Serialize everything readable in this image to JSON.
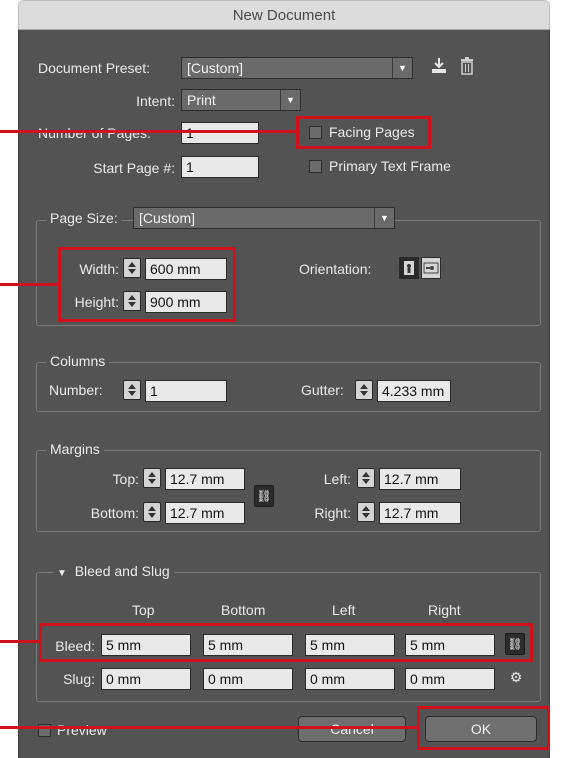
{
  "window": {
    "title": "New Document"
  },
  "document_preset": {
    "label": "Document Preset:",
    "value": "[Custom]"
  },
  "intent": {
    "label": "Intent:",
    "value": "Print"
  },
  "number_of_pages": {
    "label": "Number of Pages:",
    "value": "1"
  },
  "start_page": {
    "label": "Start Page #:",
    "value": "1"
  },
  "facing_pages": {
    "label": "Facing Pages",
    "checked": false
  },
  "primary_text_frame": {
    "label": "Primary Text Frame",
    "checked": false
  },
  "page_size": {
    "label": "Page Size:",
    "value": "[Custom]",
    "width_label": "Width:",
    "width": "600 mm",
    "height_label": "Height:",
    "height": "900 mm",
    "orientation_label": "Orientation:"
  },
  "columns": {
    "title": "Columns",
    "number_label": "Number:",
    "number": "1",
    "gutter_label": "Gutter:",
    "gutter": "4.233 mm"
  },
  "margins": {
    "title": "Margins",
    "top_label": "Top:",
    "top": "12.7 mm",
    "bottom_label": "Bottom:",
    "bottom": "12.7 mm",
    "left_label": "Left:",
    "left": "12.7 mm",
    "right_label": "Right:",
    "right": "12.7 mm"
  },
  "bleed_slug": {
    "title": "Bleed and Slug",
    "columns": [
      "Top",
      "Bottom",
      "Left",
      "Right"
    ],
    "bleed_label": "Bleed:",
    "bleed": [
      "5 mm",
      "5 mm",
      "5 mm",
      "5 mm"
    ],
    "slug_label": "Slug:",
    "slug": [
      "0 mm",
      "0 mm",
      "0 mm",
      "0 mm"
    ]
  },
  "footer": {
    "preview_label": "Preview",
    "cancel_label": "Cancel",
    "ok_label": "OK"
  },
  "colors": {
    "dialog_bg": "#535353",
    "field_bg": "#e9e9e9",
    "annotation_red": "#d0101a"
  }
}
